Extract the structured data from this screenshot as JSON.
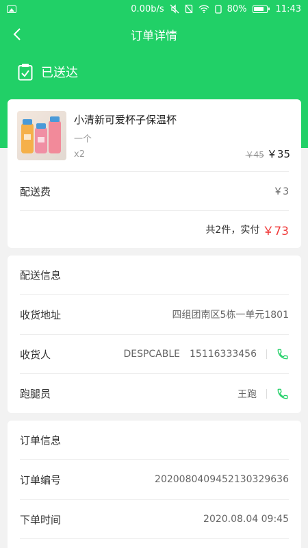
{
  "status_bar": {
    "net_speed": "0.00b/s",
    "battery": "80%",
    "time": "11:43"
  },
  "nav": {
    "title": "订单详情"
  },
  "order_status": {
    "label": "已送达"
  },
  "product": {
    "name": "小清新可爱杯子保温杯",
    "spec": "一个",
    "qty": "x2",
    "old_price": "￥45",
    "price": "￥35"
  },
  "delivery_fee": {
    "label": "配送费",
    "value": "￥3"
  },
  "total": {
    "prefix": "共2件，实付",
    "amount": "￥73"
  },
  "delivery_info": {
    "title": "配送信息",
    "address_label": "收货地址",
    "address": "四组团南区5栋一单元1801",
    "receiver_label": "收货人",
    "receiver_name": "DESPCABLE",
    "receiver_phone": "15116333456",
    "runner_label": "跑腿员",
    "runner_name": "王跑"
  },
  "order_info": {
    "title": "订单信息",
    "number_label": "订单编号",
    "number": "202008040945213032963​6",
    "time_label": "下单时间",
    "time": "2020.08.04 09:45"
  },
  "colors": {
    "brand_green": "#21d067",
    "price_red": "#f03c3c"
  }
}
